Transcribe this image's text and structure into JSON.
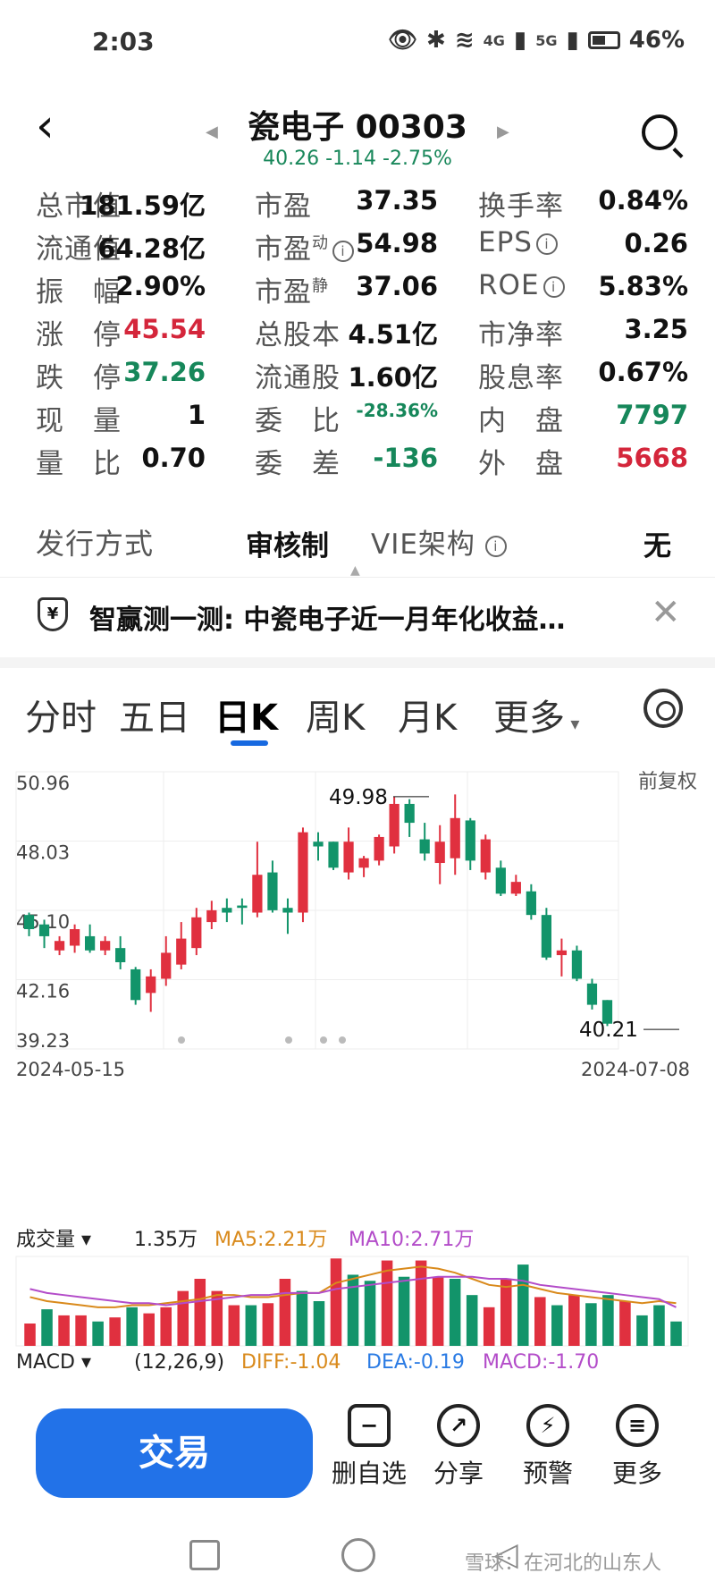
{
  "status": {
    "time": "2:03",
    "net1": "4G",
    "net2": "5G",
    "battery": "46%"
  },
  "header": {
    "title": "瓷电子 00303",
    "quote": "40.26 -1.14 -2.75%"
  },
  "stats": [
    [
      "总市值",
      "181.59亿",
      "市盈",
      "37.35",
      "换手率",
      "0.84%"
    ],
    [
      "流通值",
      "64.28亿",
      "市盈",
      "54.98",
      "EPS",
      "0.26"
    ],
    [
      "振　幅",
      "2.90%",
      "市盈",
      "37.06",
      "ROE",
      "5.83%"
    ],
    [
      "涨　停",
      "45.54",
      "总股本",
      "4.51亿",
      "市净率",
      "3.25"
    ],
    [
      "跌　停",
      "37.26",
      "流通股",
      "1.60亿",
      "股息率",
      "0.67%"
    ],
    [
      "现　量",
      "1",
      "委　比",
      "-28.36%",
      "内　盘",
      "7797"
    ],
    [
      "量　比",
      "0.70",
      "委　差",
      "-136",
      "外　盘",
      "5668"
    ]
  ],
  "stats_sup": {
    "dyn": "动",
    "static": "静"
  },
  "issuance": {
    "label": "发行方式",
    "value": "审核制",
    "vie_label": "VIE架构",
    "vie_value": "无"
  },
  "notice": {
    "text": "智赢测一测: 中瓷电子近一月年化收益…"
  },
  "tabs": [
    "分时",
    "五日",
    "日K",
    "周K",
    "月K",
    "更多"
  ],
  "chart_data": {
    "type": "candlestick",
    "yticks": [
      "50.96",
      "48.03",
      "45.10",
      "42.16",
      "39.23"
    ],
    "ylim": [
      39.23,
      50.96
    ],
    "xlabels": [
      "2024-05-15",
      "2024-07-08"
    ],
    "adj_label": "前复权",
    "high_label": "49.98",
    "low_label": "40.21",
    "candles": [
      [
        44.3,
        44.9,
        44.0,
        45.0,
        "g"
      ],
      [
        44.0,
        44.5,
        43.5,
        44.7,
        "g"
      ],
      [
        43.4,
        43.8,
        43.2,
        44.0,
        "r"
      ],
      [
        43.6,
        44.3,
        43.3,
        44.5,
        "r"
      ],
      [
        44.0,
        43.4,
        43.3,
        44.5,
        "g"
      ],
      [
        43.4,
        43.8,
        43.2,
        44.0,
        "r"
      ],
      [
        43.5,
        42.9,
        42.6,
        44.0,
        "g"
      ],
      [
        42.6,
        41.3,
        41.1,
        42.7,
        "g"
      ],
      [
        41.6,
        42.3,
        40.8,
        42.6,
        "r"
      ],
      [
        42.2,
        43.3,
        41.9,
        44.0,
        "r"
      ],
      [
        42.8,
        43.9,
        42.6,
        44.6,
        "r"
      ],
      [
        43.5,
        44.8,
        43.2,
        45.2,
        "r"
      ],
      [
        44.6,
        45.1,
        44.3,
        45.5,
        "r"
      ],
      [
        45.2,
        45.0,
        44.6,
        45.6,
        "g"
      ],
      [
        45.3,
        45.2,
        44.5,
        45.6,
        "g"
      ],
      [
        45.0,
        46.6,
        44.8,
        48.0,
        "r"
      ],
      [
        46.7,
        45.1,
        45.0,
        47.2,
        "g"
      ],
      [
        45.2,
        45.0,
        44.1,
        45.6,
        "g"
      ],
      [
        45.0,
        48.4,
        44.6,
        48.6,
        "r"
      ],
      [
        48.0,
        47.8,
        47.2,
        48.4,
        "g"
      ],
      [
        48.0,
        46.9,
        46.8,
        48.0,
        "g"
      ],
      [
        46.7,
        48.0,
        46.4,
        48.6,
        "r"
      ],
      [
        46.9,
        47.3,
        46.5,
        47.4,
        "r"
      ],
      [
        47.2,
        48.2,
        47.0,
        48.3,
        "r"
      ],
      [
        47.8,
        49.6,
        47.5,
        49.9,
        "r"
      ],
      [
        49.6,
        48.8,
        48.2,
        49.8,
        "g"
      ],
      [
        48.1,
        47.5,
        47.2,
        48.8,
        "g"
      ],
      [
        47.1,
        48.0,
        46.2,
        48.7,
        "r"
      ],
      [
        47.3,
        49.0,
        46.6,
        50.0,
        "r"
      ],
      [
        48.9,
        47.2,
        46.8,
        49.0,
        "g"
      ],
      [
        48.1,
        46.7,
        46.4,
        48.3,
        "r"
      ],
      [
        46.9,
        45.8,
        45.7,
        47.2,
        "g"
      ],
      [
        46.3,
        45.8,
        45.7,
        46.6,
        "r"
      ],
      [
        45.9,
        44.9,
        44.7,
        46.2,
        "g"
      ],
      [
        44.9,
        43.1,
        43.0,
        45.2,
        "g"
      ],
      [
        43.4,
        43.2,
        42.3,
        43.9,
        "r"
      ],
      [
        43.4,
        42.2,
        42.1,
        43.6,
        "g"
      ],
      [
        42.0,
        41.1,
        40.9,
        42.2,
        "g"
      ],
      [
        40.3,
        41.3,
        40.2,
        41.3,
        "g"
      ]
    ]
  },
  "volume": {
    "label": "成交量",
    "value": "1.35万",
    "ma5": "MA5:2.21万",
    "ma10": "MA10:2.71万",
    "macd": "MACD",
    "macd_params": "(12,26,9)",
    "diff": "DIFF:-1.04",
    "dea": "DEA:-0.19",
    "macd_val": "MACD:-1.70",
    "bars": [
      [
        1.1,
        "r"
      ],
      [
        1.8,
        "g"
      ],
      [
        1.5,
        "r"
      ],
      [
        1.5,
        "r"
      ],
      [
        1.2,
        "g"
      ],
      [
        1.4,
        "r"
      ],
      [
        1.9,
        "g"
      ],
      [
        1.6,
        "r"
      ],
      [
        1.9,
        "r"
      ],
      [
        2.7,
        "r"
      ],
      [
        3.3,
        "r"
      ],
      [
        2.7,
        "r"
      ],
      [
        2.0,
        "r"
      ],
      [
        2.0,
        "g"
      ],
      [
        2.1,
        "r"
      ],
      [
        3.3,
        "r"
      ],
      [
        2.7,
        "g"
      ],
      [
        2.2,
        "g"
      ],
      [
        4.3,
        "r"
      ],
      [
        3.5,
        "g"
      ],
      [
        3.2,
        "g"
      ],
      [
        4.2,
        "r"
      ],
      [
        3.4,
        "g"
      ],
      [
        4.2,
        "r"
      ],
      [
        3.4,
        "r"
      ],
      [
        3.3,
        "g"
      ],
      [
        2.5,
        "g"
      ],
      [
        1.9,
        "r"
      ],
      [
        3.3,
        "r"
      ],
      [
        4.0,
        "g"
      ],
      [
        2.4,
        "r"
      ],
      [
        2.0,
        "g"
      ],
      [
        2.5,
        "r"
      ],
      [
        2.1,
        "g"
      ],
      [
        2.5,
        "g"
      ],
      [
        2.2,
        "r"
      ],
      [
        1.5,
        "g"
      ],
      [
        2.0,
        "g"
      ],
      [
        1.2,
        "g"
      ]
    ],
    "ma5_line": [
      2.4,
      2.2,
      2.1,
      2.0,
      1.9,
      1.9,
      2.0,
      2.0,
      2.1,
      2.2,
      2.3,
      2.5,
      2.5,
      2.4,
      2.4,
      2.5,
      2.6,
      2.6,
      3.1,
      3.3,
      3.5,
      3.7,
      3.8,
      3.9,
      3.8,
      3.6,
      3.3,
      3.0,
      2.9,
      3.0,
      2.8,
      2.6,
      2.5,
      2.4,
      2.3,
      2.2,
      2.1,
      2.2,
      2.1
    ],
    "ma10_line": [
      2.8,
      2.6,
      2.5,
      2.4,
      2.3,
      2.2,
      2.1,
      2.1,
      2.0,
      2.1,
      2.2,
      2.3,
      2.4,
      2.5,
      2.5,
      2.6,
      2.6,
      2.6,
      2.8,
      2.9,
      3.0,
      3.1,
      3.2,
      3.3,
      3.4,
      3.4,
      3.4,
      3.3,
      3.3,
      3.2,
      3.0,
      2.9,
      2.8,
      2.7,
      2.6,
      2.5,
      2.4,
      2.3,
      1.9
    ]
  },
  "colors": {
    "up": "#e0303f",
    "down": "#12946a",
    "ma5": "#d98a1c",
    "ma10": "#b34cc9",
    "accent": "#2272e8"
  },
  "actions": {
    "trade": "交易",
    "items": [
      "删自选",
      "分享",
      "预警",
      "更多"
    ]
  },
  "watermark": "雪球：在河北的山东人"
}
